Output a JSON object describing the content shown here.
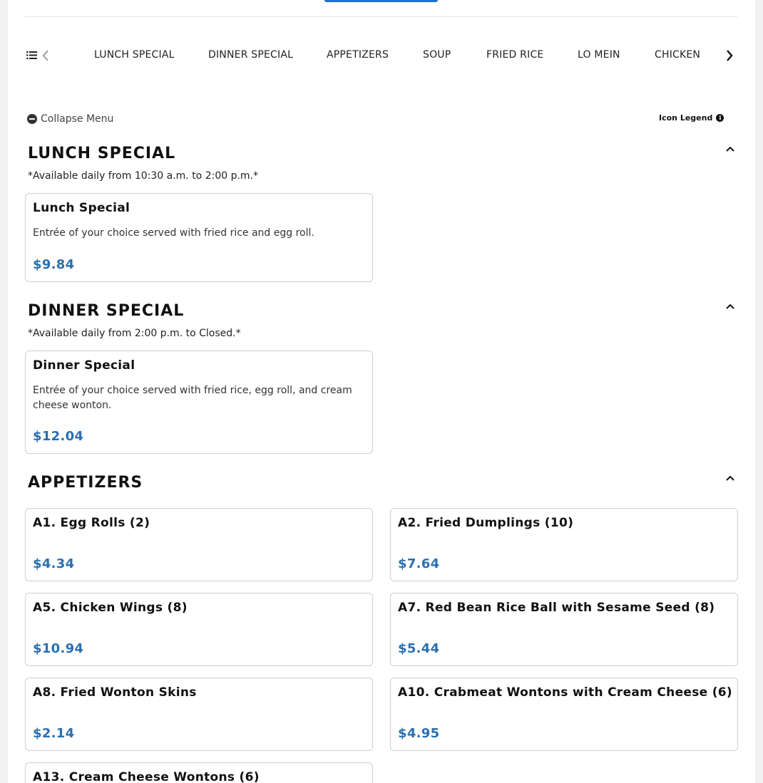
{
  "categories": [
    "LUNCH SPECIAL",
    "DINNER SPECIAL",
    "APPETIZERS",
    "SOUP",
    "FRIED RICE",
    "LO MEIN",
    "CHICKEN"
  ],
  "toolbar": {
    "collapse_label": "Collapse Menu",
    "legend_label": "Icon Legend"
  },
  "sections": {
    "lunch": {
      "title": "LUNCH SPECIAL",
      "note": "*Available daily from 10:30 a.m. to 2:00 p.m.*",
      "item": {
        "name": "Lunch Special",
        "desc": "Entrée of your choice served with fried rice and egg roll.",
        "price": "$9.84"
      }
    },
    "dinner": {
      "title": "DINNER SPECIAL",
      "note": "*Available daily from 2:00 p.m. to Closed.*",
      "item": {
        "name": "Dinner Special",
        "desc": "Entrée of your choice served with fried rice, egg roll, and cream cheese wonton.",
        "price": "$12.04"
      }
    },
    "appetizers": {
      "title": "APPETIZERS",
      "items": [
        {
          "name": "A1. Egg Rolls (2)",
          "price": "$4.34"
        },
        {
          "name": "A2. Fried Dumplings (10)",
          "price": "$7.64"
        },
        {
          "name": "A5. Chicken Wings (8)",
          "price": "$10.94"
        },
        {
          "name": "A7. Red Bean Rice Ball with Sesame Seed (8)",
          "price": "$5.44"
        },
        {
          "name": "A8. Fried Wonton Skins",
          "price": "$2.14"
        },
        {
          "name": "A10. Crabmeat Wontons with Cream Cheese (6)",
          "price": "$4.95"
        },
        {
          "name": "A13. Cream Cheese Wontons (6)",
          "price": ""
        }
      ]
    }
  },
  "colors": {
    "accent": "#2a6fb0",
    "top_button": "#1f6fd0"
  },
  "icons": [
    "list-icon",
    "chevron-left-icon",
    "chevron-right-icon",
    "minus-circle-icon",
    "info-icon",
    "chevron-up-icon"
  ]
}
